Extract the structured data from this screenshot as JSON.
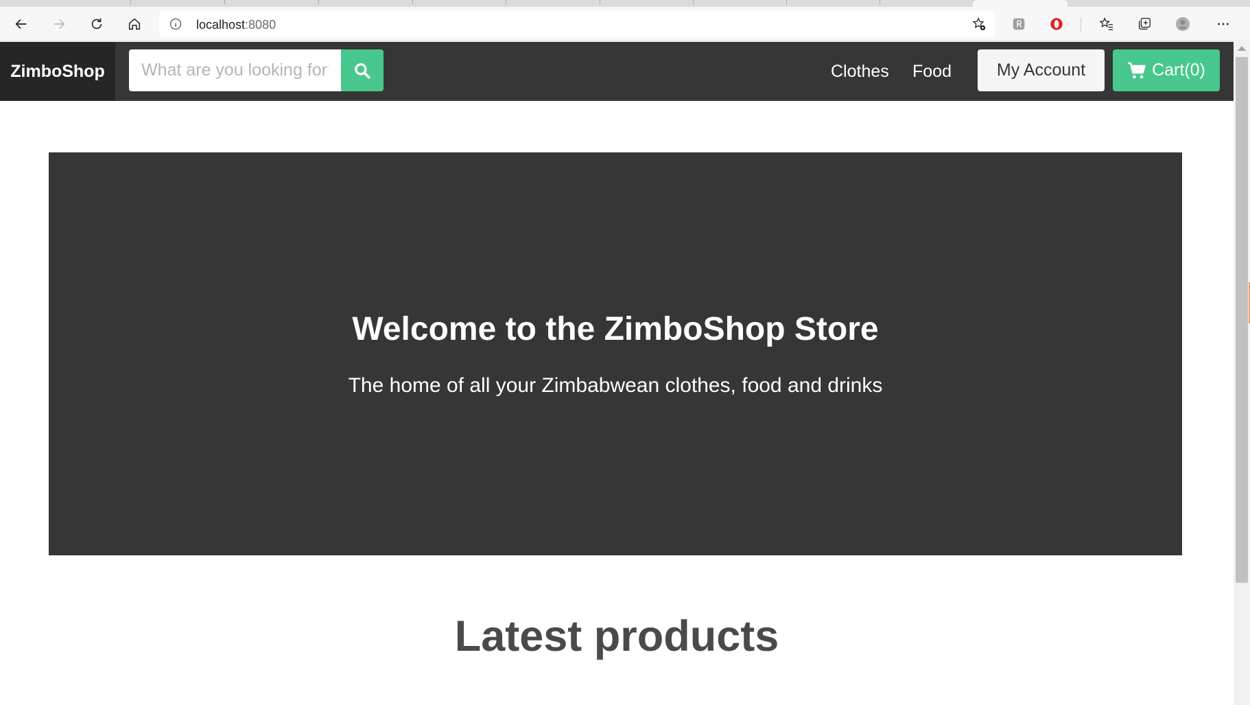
{
  "browser": {
    "url_host": "localhost",
    "url_port": ":8080",
    "icons": {
      "back": "back-arrow-icon",
      "forward": "forward-arrow-icon",
      "reload": "reload-icon",
      "home": "home-icon",
      "info": "info-icon",
      "favorite_add": "favorite-add-icon",
      "extension": "extension-icon",
      "opera": "opera-icon",
      "favorites": "favorites-icon",
      "collections": "collections-icon",
      "profile": "profile-icon",
      "menu": "more-menu-icon"
    }
  },
  "navbar": {
    "brand": "ZimboShop",
    "search_placeholder": "What are you looking for?",
    "links": [
      "Clothes",
      "Food"
    ],
    "account_label": "My Account",
    "cart_label": "Cart(0)"
  },
  "hero": {
    "title": "Welcome to the ZimboShop Store",
    "subtitle": "The home of all your Zimbabwean clothes, food and drinks"
  },
  "main": {
    "section_title": "Latest products"
  },
  "colors": {
    "dark": "#363636",
    "brand_bg": "#262626",
    "accent": "#48c78e",
    "light_button": "#f5f5f5"
  }
}
